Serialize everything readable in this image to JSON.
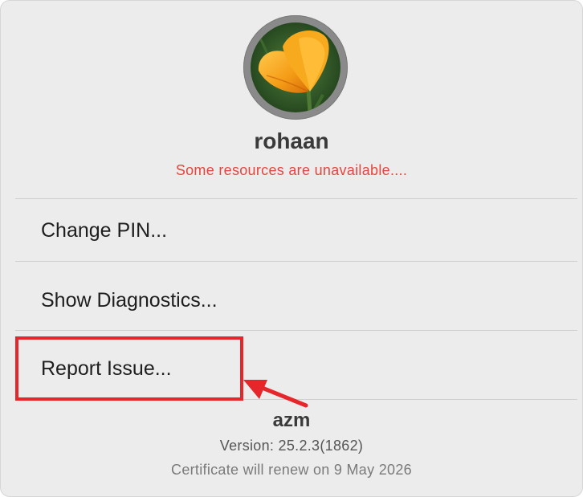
{
  "profile": {
    "user_name": "rohaan",
    "status_message": "Some resources are unavailable....",
    "avatar_icon": "flower-photo"
  },
  "menu": {
    "items": [
      {
        "label": "Change PIN..."
      },
      {
        "label": "Show Diagnostics..."
      },
      {
        "label": "Report Issue..."
      }
    ]
  },
  "footer": {
    "app_name": "azm",
    "version": "Version: 25.2.3(1862)",
    "certificate": "Certificate will renew on 9 May 2026"
  },
  "colors": {
    "status_error": "#e5453f",
    "annotation_red": "#e5262a",
    "panel_background": "#ececec"
  }
}
